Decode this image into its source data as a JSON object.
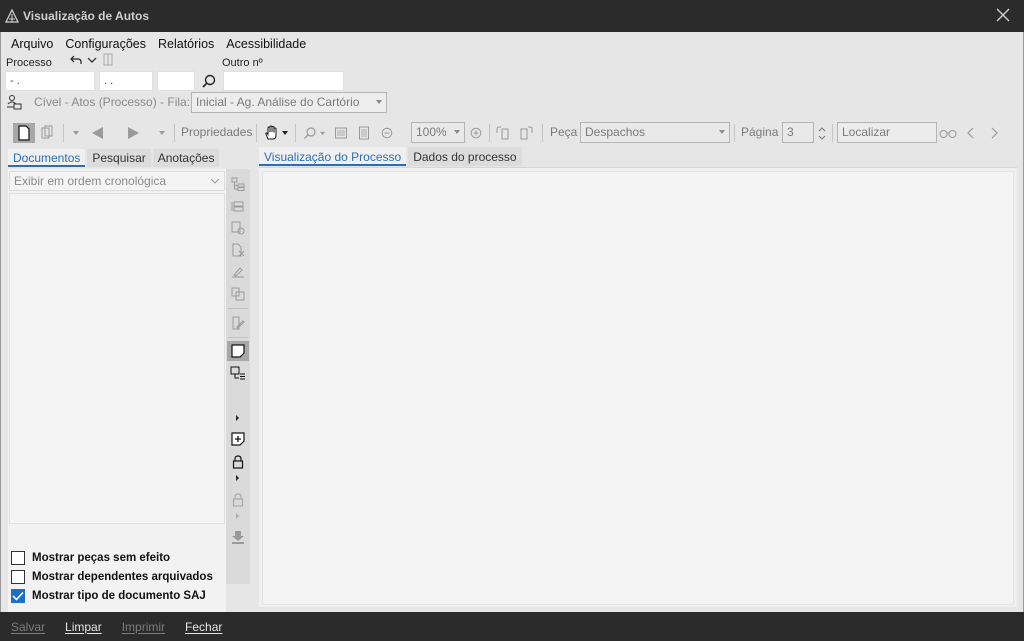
{
  "window": {
    "title": "Visualização de Autos"
  },
  "menu": {
    "items": [
      "Arquivo",
      "Configurações",
      "Relatórios",
      "Acessibilidade"
    ]
  },
  "processo": {
    "label": "Processo",
    "field1": "-  .",
    "field2": ".  .",
    "field3": "",
    "outro_label": "Outro nº",
    "outro_value": ""
  },
  "fila": {
    "text": "Cível - Atos (Processo) - Fila:",
    "selected": "Inicial - Ag. Análise do Cartório"
  },
  "toolbar": {
    "properties_label": "Propriedades",
    "zoom": "100%",
    "peca_label": "Peça",
    "peca_value": "Despachos",
    "pagina_label": "Página",
    "pagina_value": "3",
    "localizar_placeholder": "Localizar"
  },
  "left_tabs": [
    "Documentos",
    "Pesquisar",
    "Anotações"
  ],
  "order_select": "Exibir em ordem cronológica",
  "checkboxes": [
    {
      "label": "Mostrar peças sem efeito",
      "checked": false
    },
    {
      "label": "Mostrar dependentes arquivados",
      "checked": false
    },
    {
      "label": "Mostrar tipo de documento SAJ",
      "checked": true
    }
  ],
  "right_tabs": [
    "Visualização do Processo",
    "Dados do processo"
  ],
  "footer": {
    "buttons": [
      {
        "label": "Salvar",
        "enabled": false
      },
      {
        "label": "Limpar",
        "enabled": true
      },
      {
        "label": "Imprimir",
        "enabled": false
      },
      {
        "label": "Fechar",
        "enabled": true
      }
    ]
  },
  "colors": {
    "titlebar": "#2b2b2b",
    "accent": "#2a6fb5",
    "check": "#1b6fc4"
  }
}
